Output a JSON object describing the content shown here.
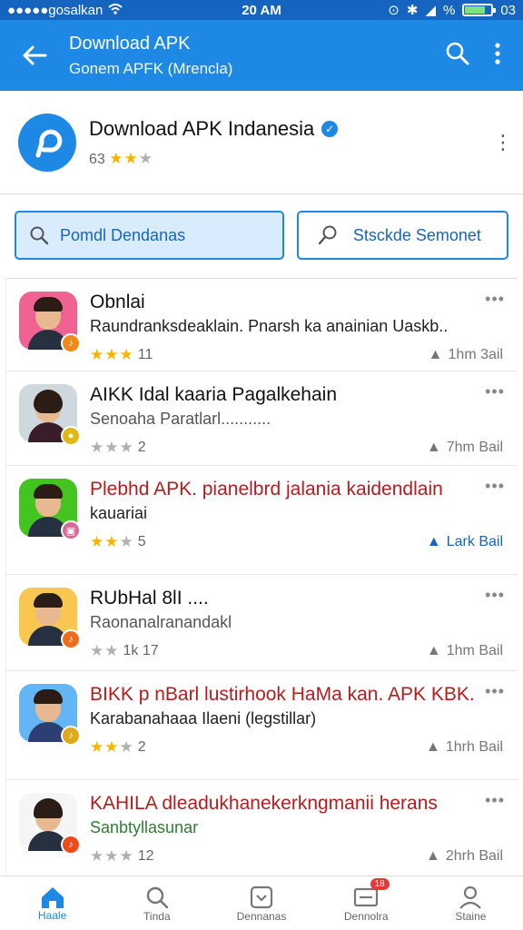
{
  "status_bar": {
    "carrier": "●●●●●gosalkan",
    "time": "20 AM",
    "battery_text": "03",
    "signal_text": "%"
  },
  "app_bar": {
    "title": "Download APK",
    "subtitle": "Gonem APFK (Mrencla)"
  },
  "header": {
    "app_name": "Download APK Indanesia",
    "meta": "63",
    "rating": 2.5
  },
  "buttons": {
    "primary_label": "Pomdl Dendanas",
    "secondary_label": "Stsckde Semonet"
  },
  "feed": [
    {
      "title": "Obnlai",
      "subtitle": "Raundranksdeaklain. Pnarsh ka anainian Uaskb..",
      "stars": 3,
      "count": "11",
      "stat": "1hm 3ail",
      "title_color": "black",
      "sub_color": "mixed",
      "avatar_bg": "#f06292",
      "badge_color": "#ef8a1a",
      "badge_icon": "♪"
    },
    {
      "title": "AIKK Idal kaaria Pagalkehain",
      "subtitle": "Senoaha Paratlarl...........",
      "stars": 2,
      "count": "2",
      "stat": "7hm Bail",
      "title_color": "black",
      "sub_color": "gray",
      "avatar_bg": "#cfd8dc",
      "badge_color": "#e0b814",
      "badge_icon": "●"
    },
    {
      "title": "Plebhd APK. pianelbrd jalania kaidendlain",
      "subtitle": "kauariai",
      "stars": 2.5,
      "count": "5",
      "stat": "Lark Bail",
      "title_color": "red",
      "sub_color": "black",
      "avatar_bg": "#43c420",
      "badge_color": "#d46a9a",
      "badge_icon": "▣"
    },
    {
      "title": "RUbHal 8lI ....",
      "subtitle": "Raonanalranandakl",
      "stars": 2,
      "count": "1k 17",
      "stat": "1hm Bail",
      "title_color": "black",
      "sub_color": "gray",
      "avatar_bg": "#f9c74f",
      "badge_color": "#ef6c1a",
      "badge_icon": "♪"
    },
    {
      "title": "BIKK p nBarl lustirhook HaMa kan. APK KBK.",
      "subtitle": "Karabanahaaa Ilaeni (legstillar)",
      "stars": 2,
      "count": "2",
      "stat": "1hrh Bail",
      "title_color": "red",
      "sub_color": "black",
      "avatar_bg": "#64b5f6",
      "badge_color": "#e0a81a",
      "badge_icon": "♪"
    },
    {
      "title": "KAHILA dleadukhanekerkngmanii herans",
      "subtitle": "Sanbtyllasunar",
      "stars": 1.5,
      "count": "12",
      "stat": "2hrh Bail",
      "title_color": "red",
      "sub_color": "green",
      "avatar_bg": "#f5f5f5",
      "badge_color": "#ef4b1a",
      "badge_icon": "♪"
    }
  ],
  "bottom_nav": [
    {
      "label": "Haale",
      "icon": "home-icon",
      "active": true
    },
    {
      "label": "Tinda",
      "icon": "search-icon",
      "active": false
    },
    {
      "label": "Dennanas",
      "icon": "download-icon",
      "active": false
    },
    {
      "label": "Dennolra",
      "icon": "inbox-icon",
      "active": false,
      "badge": "18"
    },
    {
      "label": "Staine",
      "icon": "profile-icon",
      "active": false
    }
  ]
}
